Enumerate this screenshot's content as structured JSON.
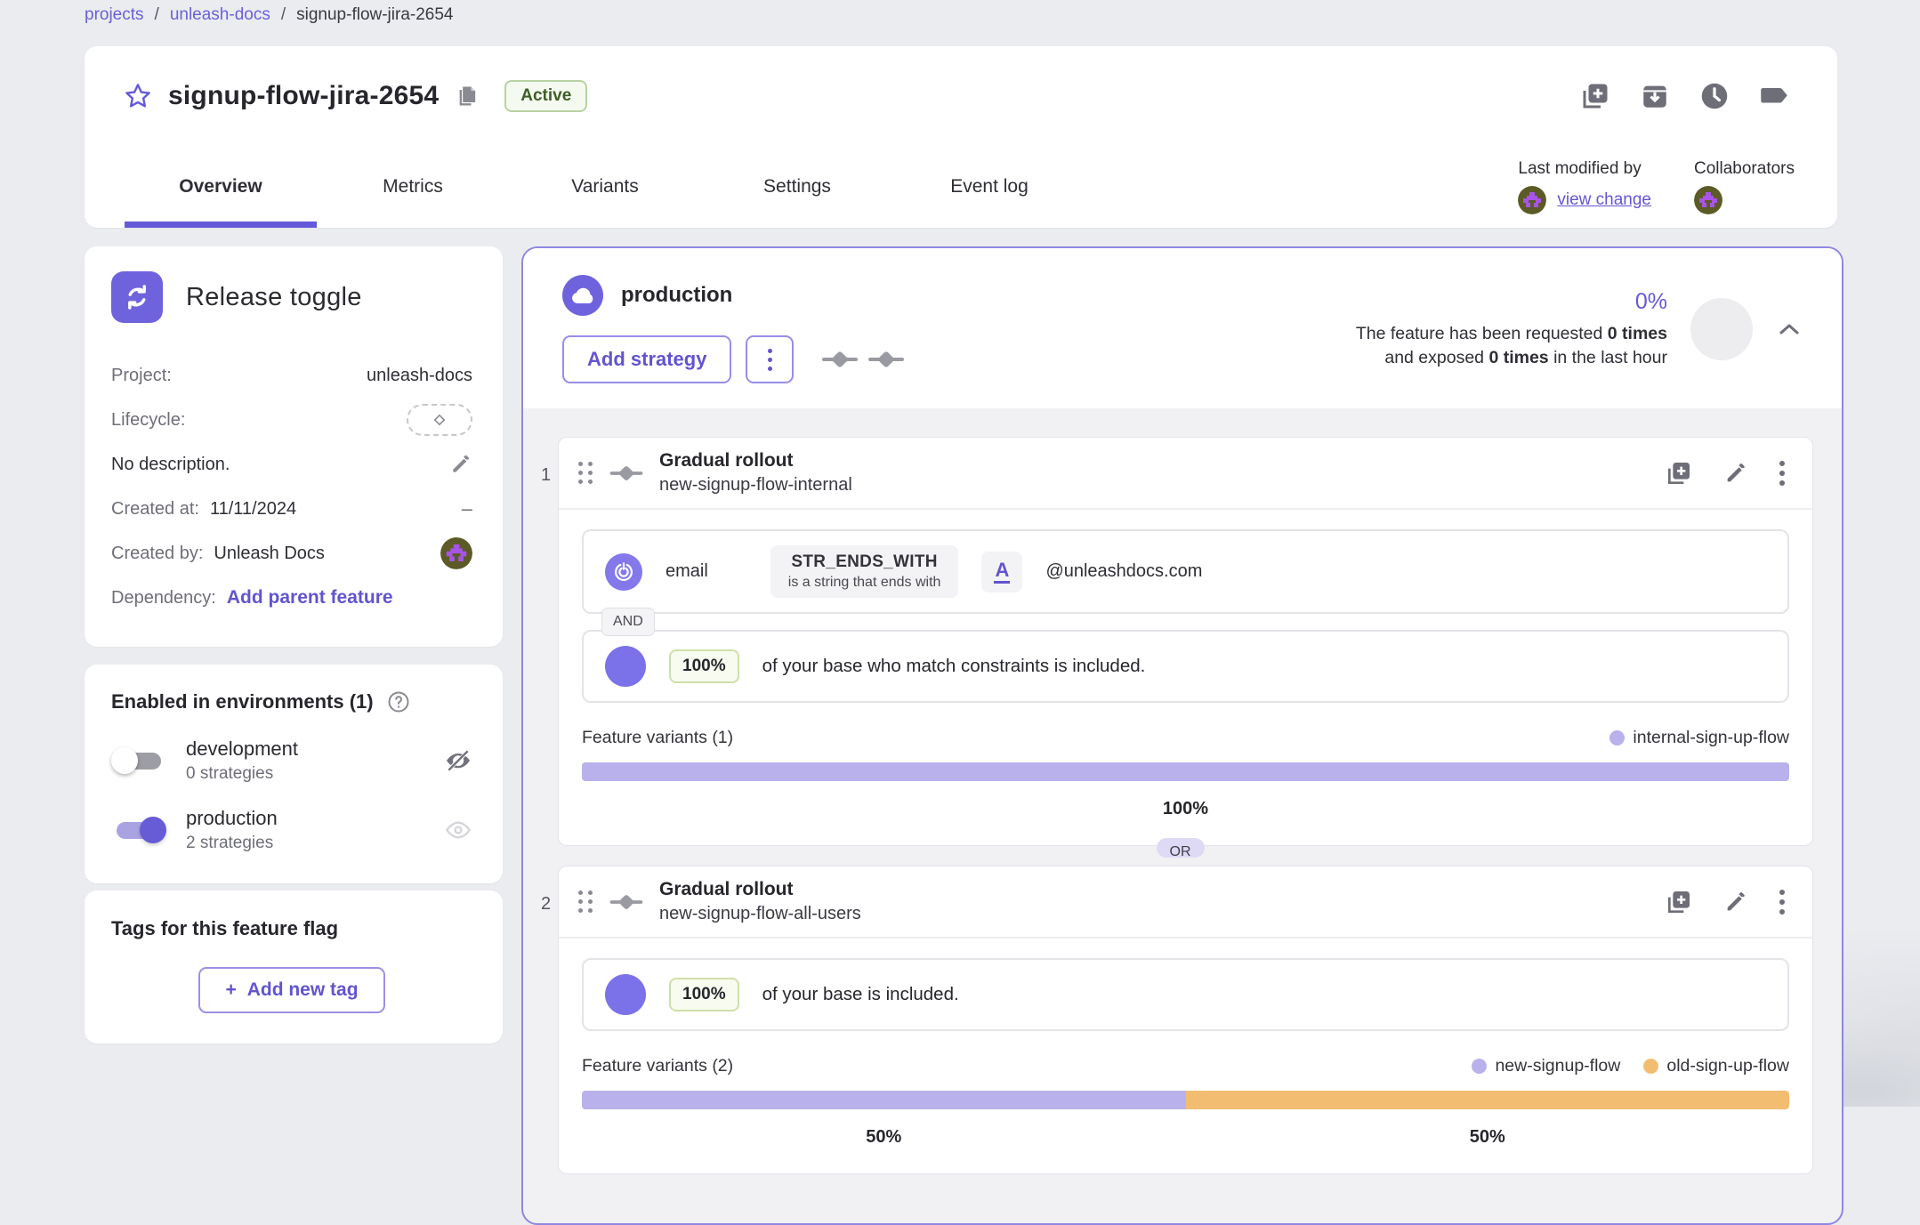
{
  "breadcrumb": {
    "separator": "/",
    "items": [
      {
        "label": "projects"
      },
      {
        "label": "unleash-docs"
      },
      {
        "label": "signup-flow-jira-2654"
      }
    ]
  },
  "header": {
    "title": "signup-flow-jira-2654",
    "status_badge": "Active"
  },
  "tabs": [
    {
      "label": "Overview",
      "active": true
    },
    {
      "label": "Metrics",
      "active": false
    },
    {
      "label": "Variants",
      "active": false
    },
    {
      "label": "Settings",
      "active": false
    },
    {
      "label": "Event log",
      "active": false
    }
  ],
  "collaboration": {
    "last_modified_label": "Last modified by",
    "view_change_link": "view change",
    "collaborators_label": "Collaborators"
  },
  "sidebar": {
    "type_card": {
      "title": "Release toggle",
      "project_label": "Project:",
      "project_value": "unleash-docs",
      "lifecycle_label": "Lifecycle:",
      "description": "No description.",
      "created_at_label": "Created at:",
      "created_at_value": "11/11/2024",
      "created_at_placeholder": "–",
      "created_by_label": "Created by:",
      "created_by_value": "Unleash Docs",
      "dependency_label": "Dependency:",
      "dependency_action": "Add parent feature"
    },
    "environments_card": {
      "title": "Enabled in environments (1)",
      "environments": [
        {
          "name": "development",
          "strategies": "0 strategies",
          "enabled": false
        },
        {
          "name": "production",
          "strategies": "2 strategies",
          "enabled": true
        }
      ]
    },
    "tags_card": {
      "title": "Tags for this feature flag",
      "add_button_plus": "+",
      "add_button_label": "Add new tag"
    }
  },
  "environment_panel": {
    "name": "production",
    "add_strategy_label": "Add strategy",
    "metrics": {
      "percentage": "0%",
      "line1_normal": "The feature has been requested ",
      "line1_bold": "0 times",
      "line2_pre": "and exposed ",
      "line2_bold": "0 times",
      "line2_post": " in the last hour"
    },
    "and_label": "AND",
    "or_label": "OR",
    "strategies": [
      {
        "index": "1",
        "type": "Gradual rollout",
        "name": "new-signup-flow-internal",
        "constraint": {
          "field": "email",
          "operator": "STR_ENDS_WITH",
          "operator_description": "is a string that ends with",
          "case_sensitive_glyph": "A",
          "value": "@unleashdocs.com"
        },
        "rollout": {
          "percentage": "100%",
          "text": "of your base who match constraints is included."
        },
        "variants": {
          "label": "Feature variants (1)",
          "items": [
            {
              "name": "internal-sign-up-flow",
              "weight": "100%",
              "color": "#b9b1ec"
            }
          ]
        }
      },
      {
        "index": "2",
        "type": "Gradual rollout",
        "name": "new-signup-flow-all-users",
        "rollout": {
          "percentage": "100%",
          "text": "of your base is included."
        },
        "variants": {
          "label": "Feature variants (2)",
          "items": [
            {
              "name": "new-signup-flow",
              "weight": "50%",
              "color": "#b9b1ec"
            },
            {
              "name": "old-sign-up-flow",
              "weight": "50%",
              "color": "#f2bd70"
            }
          ]
        }
      }
    ]
  },
  "colors": {
    "accent_purple": "#6459d8",
    "variant_purple": "#b9b1ec",
    "variant_orange": "#f2bd70",
    "active_badge_green": "#3e5e27",
    "panel_border_purple": "#8f87e2"
  }
}
